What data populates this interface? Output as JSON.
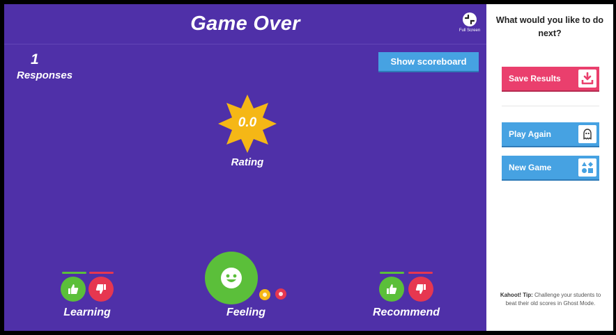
{
  "header": {
    "title": "Game Over",
    "fullscreen_label": "Full Screen"
  },
  "responses": {
    "count": "1",
    "label": "Responses"
  },
  "scoreboard": {
    "label": "Show scoreboard"
  },
  "rating": {
    "value": "0.0",
    "label": "Rating"
  },
  "sections": {
    "learning": {
      "label": "Learning"
    },
    "feeling": {
      "label": "Feeling"
    },
    "recommend": {
      "label": "Recommend"
    }
  },
  "sidebar": {
    "question": "What would you like to do next?",
    "save_label": "Save Results",
    "play_label": "Play Again",
    "new_label": "New Game",
    "tip_prefix": "Kahoot! Tip:",
    "tip_text": "Challenge your students to beat their old scores in Ghost Mode."
  },
  "colors": {
    "background": "#4f30a8",
    "green": "#5bbf3a",
    "red": "#e63750",
    "yellow": "#f5b716",
    "blue_button": "#46a2e2",
    "save_button": "#ea3f6d"
  },
  "icons": {
    "fullscreen": "fullscreen-exit-icon",
    "thumbs_up": "thumbs-up-icon",
    "thumbs_down": "thumbs-down-icon",
    "smiley": "smiley-face-icon",
    "download": "download-icon",
    "ghost": "ghost-icon",
    "shapes": "shapes-icon"
  }
}
